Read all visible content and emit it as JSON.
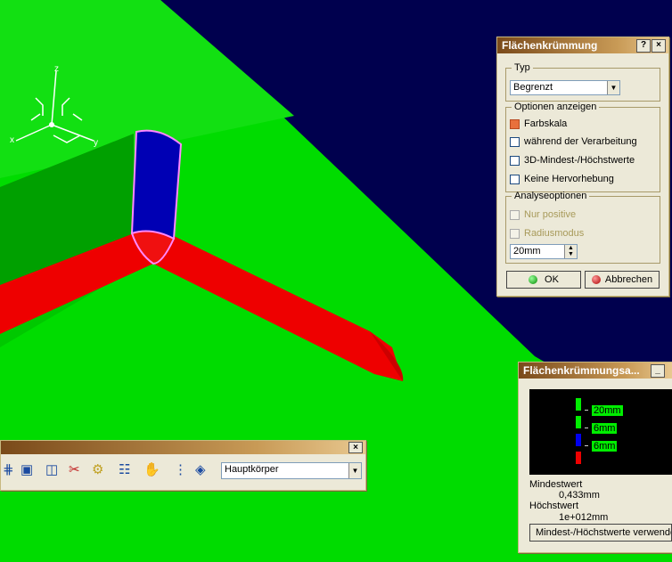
{
  "dialog": {
    "title": "Flächenkrümmung",
    "help_button": "?",
    "close_button": "×",
    "group_type": "Typ",
    "type_value": "Begrenzt",
    "group_display": "Optionen anzeigen",
    "opt_color_scale": "Farbskala",
    "opt_during_processing": "während der Verarbeitung",
    "opt_3d_minmax": "3D-Mindest-/Höchstwerte",
    "opt_no_highlight": "Keine Hervorhebung",
    "group_analysis": "Analyseoptionen",
    "opt_positive_only": "Nur positive",
    "opt_radius_mode": "Radiusmodus",
    "radius_value": "20mm",
    "ok_label": "OK",
    "cancel_label": "Abbrechen"
  },
  "scale_window": {
    "title": "Flächenkrümmungsa...",
    "min_button": "_",
    "scale_labels": [
      "20mm",
      "6mm",
      "6mm"
    ],
    "min_label": "Mindestwert",
    "min_value": "0,433mm",
    "max_label": "Höchstwert",
    "max_value": "1e+012mm",
    "use_minmax_button": "Mindest-/Höchstwerte verwende"
  },
  "toolbar": {
    "close_button": "×",
    "body_select": "Hauptkörper"
  },
  "axes": {
    "x": "x",
    "y": "y",
    "z": "z"
  },
  "colors": {
    "background": "#00004e",
    "surface": "#00dc00",
    "red": "#ee0000",
    "blue": "#0000b4",
    "highlight": "#ff88ff"
  }
}
